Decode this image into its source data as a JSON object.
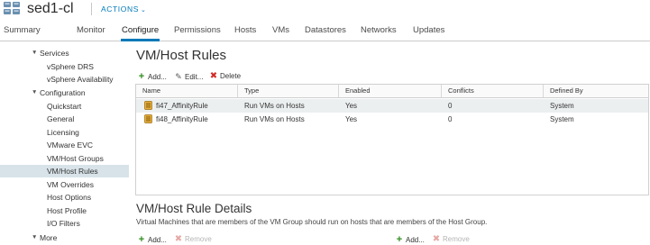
{
  "header": {
    "title": "sed1-cl",
    "actions_label": "ACTIONS",
    "icons": {
      "object": "cluster-icon",
      "actions_chevron": "chevron-down-icon"
    }
  },
  "tabs": [
    {
      "label": "Summary",
      "active": false
    },
    {
      "label": "Monitor",
      "active": false
    },
    {
      "label": "Configure",
      "active": true
    },
    {
      "label": "Permissions",
      "active": false
    },
    {
      "label": "Hosts",
      "active": false
    },
    {
      "label": "VMs",
      "active": false
    },
    {
      "label": "Datastores",
      "active": false
    },
    {
      "label": "Networks",
      "active": false
    },
    {
      "label": "Updates",
      "active": false
    }
  ],
  "sidebar": {
    "groups": [
      {
        "label": "Services",
        "expanded": true,
        "items": [
          "vSphere DRS",
          "vSphere Availability"
        ]
      },
      {
        "label": "Configuration",
        "expanded": true,
        "items": [
          "Quickstart",
          "General",
          "Licensing",
          "VMware EVC",
          "VM/Host Groups",
          "VM/Host Rules",
          "VM Overrides",
          "Host Options",
          "Host Profile",
          "I/O Filters"
        ]
      },
      {
        "label": "More",
        "expanded": true,
        "items": []
      }
    ],
    "selected": "VM/Host Rules"
  },
  "rules_panel": {
    "title": "VM/Host Rules",
    "toolbar": {
      "add": "Add...",
      "edit": "Edit...",
      "delete": "Delete"
    },
    "columns": [
      "Name",
      "Type",
      "Enabled",
      "Conflicts",
      "Defined By"
    ],
    "rows": [
      {
        "name": "fi47_AffinityRule",
        "type": "Run VMs on Hosts",
        "enabled": "Yes",
        "conflicts": "0",
        "defined_by": "System",
        "selected": true
      },
      {
        "name": "fi48_AffinityRule",
        "type": "Run VMs on Hosts",
        "enabled": "Yes",
        "conflicts": "0",
        "defined_by": "System",
        "selected": false
      }
    ]
  },
  "details_panel": {
    "title": "VM/Host Rule Details",
    "description": "Virtual Machines that are members of the VM Group should run on hosts that are members of the Host Group.",
    "left_toolbar": {
      "add": "Add...",
      "remove": "Remove"
    },
    "right_toolbar": {
      "add": "Add...",
      "remove": "Remove"
    }
  },
  "colors": {
    "accent": "#0079b8",
    "selected_row": "#eceff0",
    "selected_nav": "#d8e3e9",
    "add_green": "#2f8d1f",
    "delete_red": "#d22a24"
  }
}
